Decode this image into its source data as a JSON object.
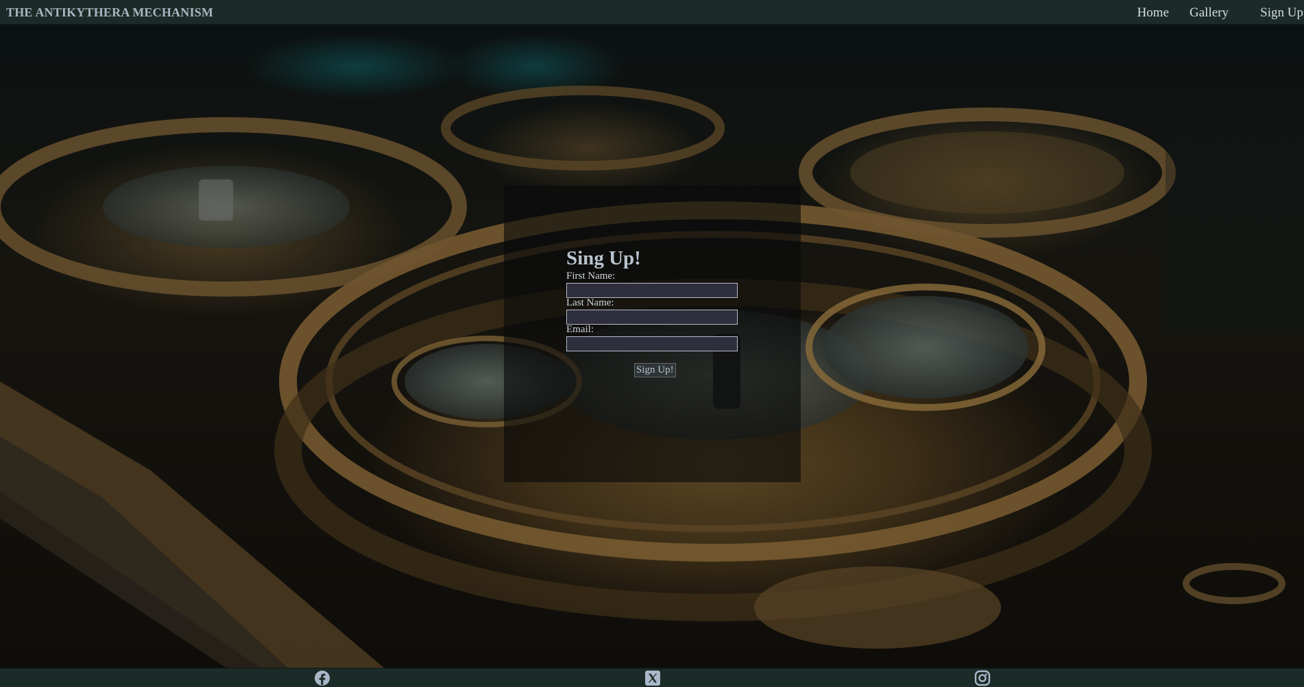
{
  "header": {
    "brand": "THE ANTIKYTHERA MECHANISM",
    "nav": [
      {
        "label": "Home"
      },
      {
        "label": "Gallery"
      },
      {
        "label": "Sign Up"
      }
    ]
  },
  "form": {
    "title": "Sing Up!",
    "fields": [
      {
        "label": "First Name:",
        "value": ""
      },
      {
        "label": "Last Name:",
        "value": ""
      },
      {
        "label": "Email:",
        "value": ""
      }
    ],
    "submit_label": "Sign Up!"
  },
  "footer": {
    "social": [
      {
        "icon": "facebook-icon"
      },
      {
        "icon": "x-twitter-icon"
      },
      {
        "icon": "instagram-icon"
      }
    ]
  },
  "colors": {
    "bar_background": "#1b2b27",
    "brand_text": "#a9b7c2",
    "input_background": "#2e2e3c",
    "social_icon": "#a9b7c9"
  }
}
